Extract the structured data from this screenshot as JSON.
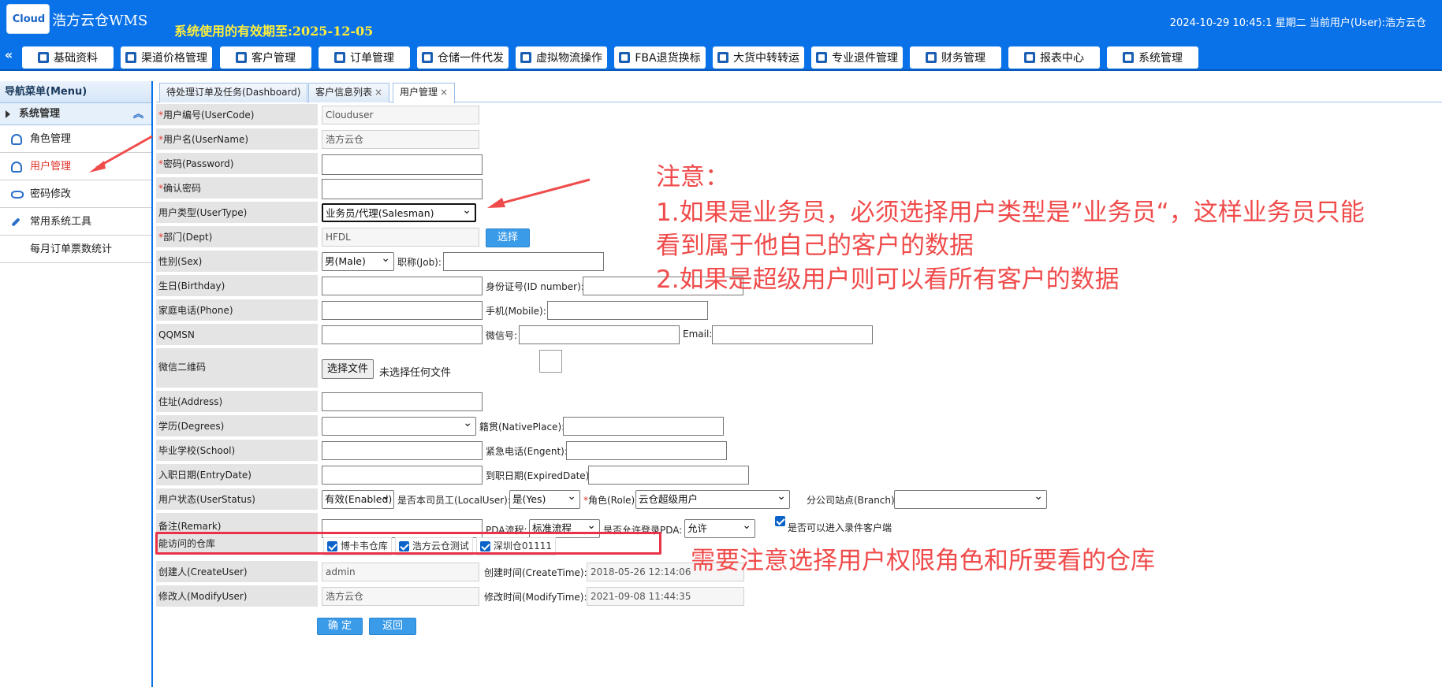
{
  "header": {
    "logo_text": "Cloud",
    "app_title": "浩方云仓WMS",
    "expire_text": "系统使用的有效期至:2025-12-05",
    "datetime_text": "2024-10-29 10:45:1   星期二   当前用户(User):浩方云仓"
  },
  "nav": {
    "collapse_glyph": "«",
    "items": [
      {
        "label": "基础资料",
        "icon": "tag-icon"
      },
      {
        "label": "渠道价格管理",
        "icon": "price-icon"
      },
      {
        "label": "客户管理",
        "icon": "user-icon"
      },
      {
        "label": "订单管理",
        "icon": "list-icon"
      },
      {
        "label": "仓储一件代发",
        "icon": "warehouse-icon"
      },
      {
        "label": "虚拟物流操作",
        "icon": "logistics-icon"
      },
      {
        "label": "FBA退货换标",
        "icon": "fba-icon"
      },
      {
        "label": "大货中转转运",
        "icon": "truck-icon"
      },
      {
        "label": "专业退件管理",
        "icon": "return-icon"
      },
      {
        "label": "财务管理",
        "icon": "finance-icon"
      },
      {
        "label": "报表中心",
        "icon": "database-icon"
      },
      {
        "label": "系统管理",
        "icon": "system-icon"
      }
    ]
  },
  "sidebar": {
    "header": "导航菜单(Menu)",
    "group": "系统管理",
    "items": [
      {
        "label": "角色管理",
        "icon": "user-role-icon",
        "active": false
      },
      {
        "label": "用户管理",
        "icon": "user-icon",
        "active": true
      },
      {
        "label": "密码修改",
        "icon": "cloud-key-icon",
        "active": false
      },
      {
        "label": "常用系统工具",
        "icon": "wrench-icon",
        "active": false
      },
      {
        "label": "每月订单票数统计",
        "icon": "",
        "active": false
      }
    ]
  },
  "tabs": [
    {
      "label": "待处理订单及任务(Dashboard)",
      "closable": false
    },
    {
      "label": "客户信息列表",
      "closable": true
    },
    {
      "label": "用户管理",
      "closable": true,
      "active": true
    }
  ],
  "tab_close_glyph": "×",
  "form": {
    "usercode": {
      "label": "用户编号(UserCode)",
      "value": "Clouduser"
    },
    "username": {
      "label": "用户名(UserName)",
      "value": "浩方云仓"
    },
    "password": {
      "label": "密码(Password)",
      "value": ""
    },
    "confirm": {
      "label": "确认密码",
      "value": ""
    },
    "usertype": {
      "label": "用户类型(UserType)",
      "value": "业务员/代理(Salesman)"
    },
    "dept": {
      "label": "部门(Dept)",
      "value": "HFDL",
      "button": "选择"
    },
    "sex": {
      "label": "性别(Sex)",
      "value": "男(Male)",
      "job_label": "职称(Job):"
    },
    "birthday": {
      "label": "生日(Birthday)",
      "id_label": "身份证号(ID number):"
    },
    "phone": {
      "label": "家庭电话(Phone)",
      "mobile_label": "手机(Mobile):"
    },
    "qqmsn": {
      "label": "QQMSN",
      "wechat_label": "微信号:",
      "email_label": "Email:"
    },
    "wechat_qr": {
      "label": "微信二维码",
      "file_button": "选择文件",
      "file_status": "未选择任何文件"
    },
    "address": {
      "label": "住址(Address)"
    },
    "degrees": {
      "label": "学历(Degrees)",
      "value": "",
      "native_label": "籍贯(NativePlace):"
    },
    "school": {
      "label": "毕业学校(School)",
      "emergency_label": "紧急电话(Engent):"
    },
    "entry": {
      "label": "入职日期(EntryDate)",
      "expired_label": "到职日期(ExpiredDate):"
    },
    "status": {
      "label": "用户状态(UserStatus)",
      "value": "有效(Enabled)",
      "local_label": "是否本司员工(LocalUser):",
      "local_value": "是(Yes)",
      "role_label": "角色(Role)",
      "role_value": "云仓超级用户",
      "branch_label": "分公司站点(Branch)",
      "branch_value": ""
    },
    "remark": {
      "label": "备注(Remark)",
      "pda_label": "PDA流程:",
      "pda_value": "标准流程",
      "pda_login_label": "是否允许登录PDA:",
      "pda_login_value": "允许",
      "enter_label": "是否可以进入录件客户端"
    },
    "warehouses": {
      "label": "能访问的仓库",
      "items": [
        "博卡韦仓库",
        "浩方云仓测试",
        "深圳仓01111"
      ]
    },
    "createuser": {
      "label": "创建人(CreateUser)",
      "value": "admin",
      "time_label": "创建时间(CreateTime):",
      "time_value": "2018-05-26 12:14:06"
    },
    "modifyuser": {
      "label": "修改人(ModifyUser)",
      "value": "浩方云仓",
      "time_label": "修改时间(ModifyTime):",
      "time_value": "2021-09-08 11:44:35"
    },
    "confirm_button": "确 定",
    "back_button": "返回"
  },
  "annotations": {
    "note1_line1": "注意：",
    "note1_line2": "1.如果是业务员，必须选择用户类型是”业务员“，这样业务员只能",
    "note1_line3": "看到属于他自己的客户的数据",
    "note1_line4": "2.如果是超级用户则可以看所有客户的数据",
    "note2": "需要注意选择用户权限角色和所要看的仓库",
    "color": "#f04b4b"
  }
}
